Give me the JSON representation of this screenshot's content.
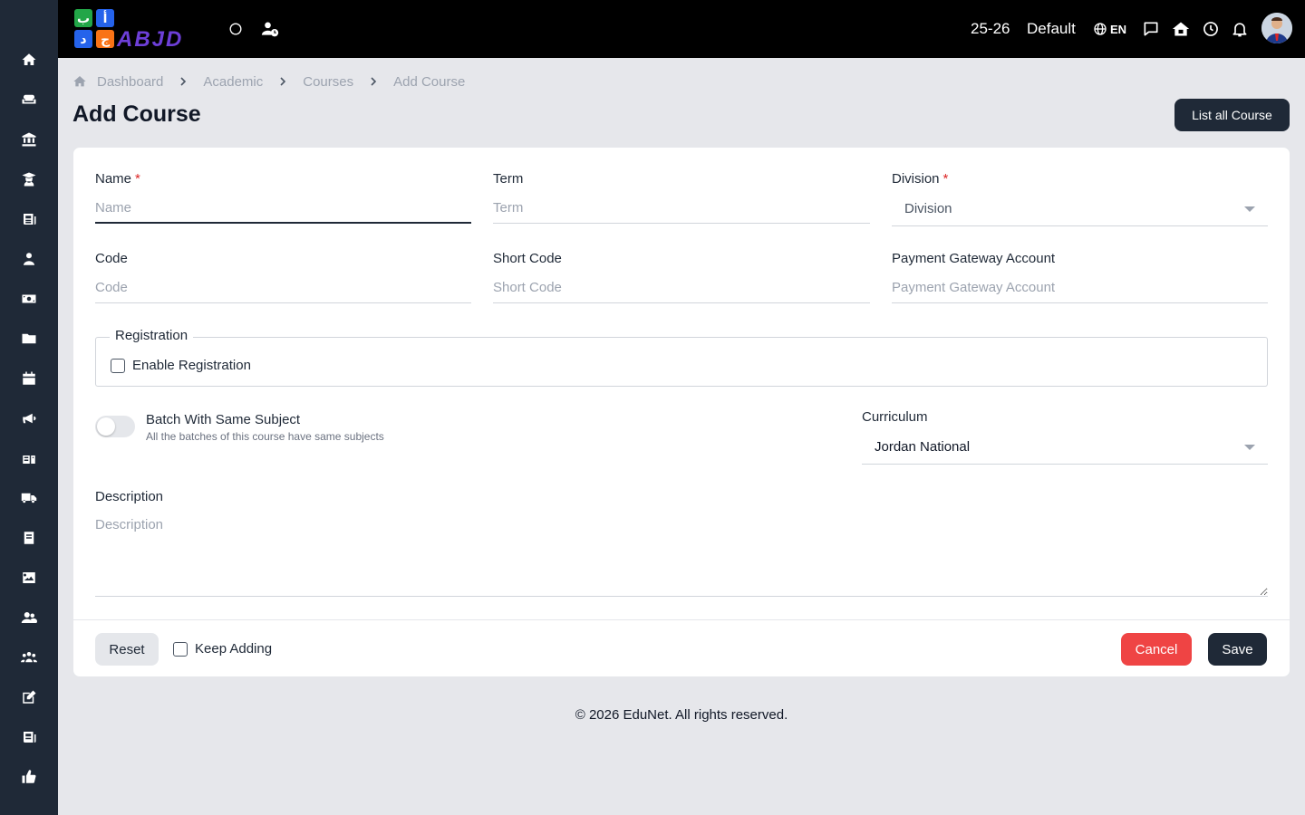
{
  "sidebar": {
    "items": [
      {
        "icon": "home-icon"
      },
      {
        "icon": "sofa-icon"
      },
      {
        "icon": "institution-icon"
      },
      {
        "icon": "graduate-icon"
      },
      {
        "icon": "news-icon"
      },
      {
        "icon": "user-tie-icon"
      },
      {
        "icon": "money-icon"
      },
      {
        "icon": "folder-icon"
      },
      {
        "icon": "calendar-icon"
      },
      {
        "icon": "megaphone-icon"
      },
      {
        "icon": "fees-icon"
      },
      {
        "icon": "truck-icon"
      },
      {
        "icon": "book-icon"
      },
      {
        "icon": "image-icon"
      },
      {
        "icon": "users-icon"
      },
      {
        "icon": "group-icon"
      },
      {
        "icon": "edit-icon"
      },
      {
        "icon": "newspaper-icon"
      },
      {
        "icon": "thumbs-up-icon"
      }
    ]
  },
  "topbar": {
    "year": "25-26",
    "profile": "Default",
    "language": "EN"
  },
  "breadcrumb": {
    "items": [
      "Dashboard",
      "Academic",
      "Courses",
      "Add Course"
    ]
  },
  "header": {
    "title": "Add Course",
    "list_button": "List all Course"
  },
  "form": {
    "name": {
      "label": "Name",
      "placeholder": "Name",
      "required": "*"
    },
    "term": {
      "label": "Term",
      "placeholder": "Term"
    },
    "division": {
      "label": "Division",
      "placeholder": "Division",
      "required": "*"
    },
    "code": {
      "label": "Code",
      "placeholder": "Code"
    },
    "short_code": {
      "label": "Short Code",
      "placeholder": "Short Code"
    },
    "payment": {
      "label": "Payment Gateway Account",
      "placeholder": "Payment Gateway Account"
    },
    "registration": {
      "legend": "Registration",
      "enable_label": "Enable Registration"
    },
    "batch": {
      "title": "Batch With Same Subject",
      "subtitle": "All the batches of this course have same subjects"
    },
    "curriculum": {
      "label": "Curriculum",
      "value": "Jordan National"
    },
    "description": {
      "label": "Description",
      "placeholder": "Description"
    }
  },
  "actions": {
    "reset": "Reset",
    "keep_adding": "Keep Adding",
    "cancel": "Cancel",
    "save": "Save"
  },
  "footer": {
    "text": "© 2026 EduNet. All rights reserved."
  },
  "colors": {
    "sidebar": "#1f2937",
    "topbar": "#000000",
    "primary": "#1f2937",
    "danger": "#ef4444"
  }
}
